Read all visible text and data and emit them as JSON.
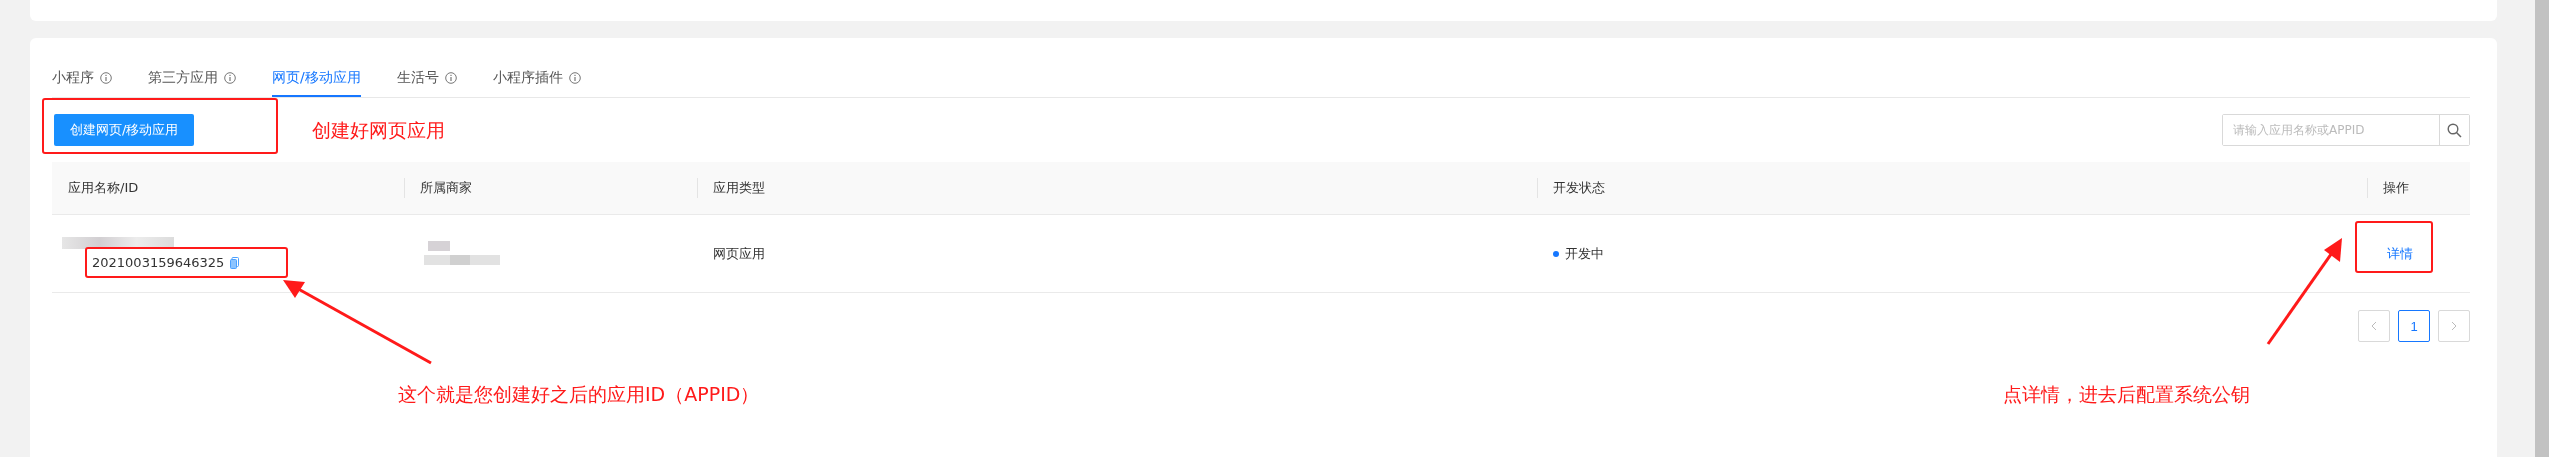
{
  "tabs": [
    {
      "label": "小程序",
      "info": true,
      "selected": false
    },
    {
      "label": "第三方应用",
      "info": true,
      "selected": false
    },
    {
      "label": "网页/移动应用",
      "info": false,
      "selected": true
    },
    {
      "label": "生活号",
      "info": true,
      "selected": false
    },
    {
      "label": "小程序插件",
      "info": true,
      "selected": false
    }
  ],
  "create_button": "创建网页/移动应用",
  "search": {
    "placeholder": "请输入应用名称或APPID"
  },
  "table": {
    "columns": [
      "应用名称/ID",
      "所属商家",
      "应用类型",
      "开发状态",
      "操作"
    ],
    "rows": [
      {
        "app_id": "2021003159646325",
        "type": "网页应用",
        "status": "开发中",
        "color": "#1677ff",
        "action": "详情"
      }
    ]
  },
  "pagination": {
    "pages": [
      {
        "label": "1",
        "selected": true
      }
    ]
  },
  "annotations": [
    {
      "text": "创建好网页应用"
    },
    {
      "text": "这个就是您创建好之后的应用ID（APPID）"
    },
    {
      "text": "点详情，进去后配置系统公钥"
    }
  ]
}
